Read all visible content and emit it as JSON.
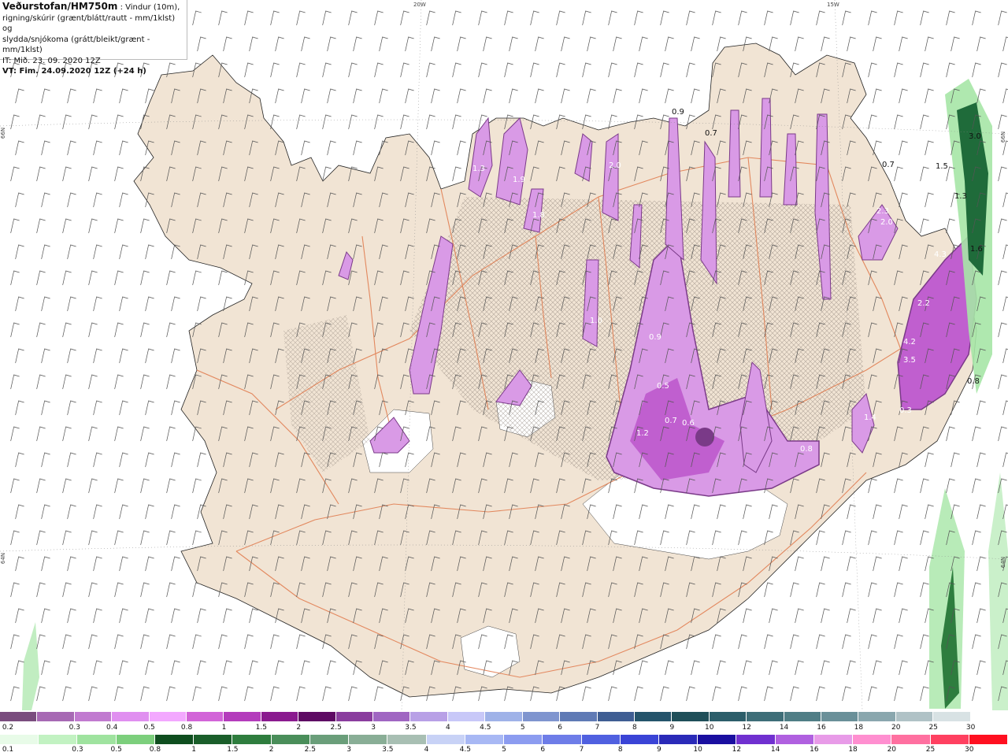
{
  "header": {
    "title": "Veðurstofan/HM750m",
    "title_suffix": " : Vindur (10m),",
    "line2": "rigning/skúrir (grænt/blátt/rautt - mm/1klst) og",
    "line3": "slydda/snjókoma (grátt/bleikt/grænt - mm/1klst)",
    "line4": "IT: Mið. 23. 09. 2020 12Z",
    "line5": "VT: Fim. 24.09.2020 12Z (+24 h)"
  },
  "map": {
    "longitude_labels": [
      "20W",
      "15W"
    ],
    "latitude_labels": [
      "66N",
      "64N",
      "66N",
      "64N"
    ],
    "colors": {
      "sea": "#ffffff",
      "land": "#f1e4d4",
      "roads": "#e0784a",
      "snow_light": "#d99ae6",
      "snow_mid": "#c05fcf",
      "snow_heavy": "#7a3a88",
      "rain_light": "#a6e6a6",
      "rain_heavy": "#1f6b3a",
      "glacier": "#ffffff",
      "wind_barb": "#555555"
    },
    "value_labels": [
      {
        "text": "0.9",
        "tone": "dark"
      },
      {
        "text": "0.7",
        "tone": "dark"
      },
      {
        "text": "3.0",
        "tone": "dark"
      },
      {
        "text": "1.5",
        "tone": "dark"
      },
      {
        "text": "1.3",
        "tone": "dark"
      },
      {
        "text": "0.7",
        "tone": "dark"
      },
      {
        "text": "1.6",
        "tone": "dark"
      },
      {
        "text": "0.8",
        "tone": "dark"
      },
      {
        "text": "1.3",
        "tone": "light"
      },
      {
        "text": "1.9",
        "tone": "light"
      },
      {
        "text": "2.0",
        "tone": "light"
      },
      {
        "text": "1.8",
        "tone": "light"
      },
      {
        "text": "4.3",
        "tone": "light"
      },
      {
        "text": "3.5",
        "tone": "light"
      },
      {
        "text": "4.2",
        "tone": "light"
      },
      {
        "text": "2.0",
        "tone": "light"
      },
      {
        "text": "2.3",
        "tone": "light"
      },
      {
        "text": "1.0",
        "tone": "light"
      },
      {
        "text": "0.9",
        "tone": "light"
      },
      {
        "text": "1.2",
        "tone": "light"
      },
      {
        "text": "0.5",
        "tone": "light"
      },
      {
        "text": "0.7",
        "tone": "light"
      },
      {
        "text": "0.6",
        "tone": "light"
      },
      {
        "text": "0.8",
        "tone": "light"
      },
      {
        "text": "1.4",
        "tone": "light"
      },
      {
        "text": "0.3",
        "tone": "light"
      },
      {
        "text": "2.2",
        "tone": "light"
      }
    ]
  },
  "legend": {
    "snow": {
      "labels": [
        "0.2",
        "0.3",
        "0.4",
        "0.5",
        "0.8",
        "1",
        "1.5",
        "2",
        "2.5",
        "3",
        "3.5",
        "4",
        "4.5",
        "5",
        "6",
        "7",
        "8",
        "9",
        "10",
        "12",
        "14",
        "16",
        "18",
        "20",
        "25",
        "30"
      ],
      "colors": [
        "#7a4d7e",
        "#a769b4",
        "#c17ad0",
        "#e08ff0",
        "#f3a8ff",
        "#d264d8",
        "#b43cbc",
        "#8a1a8f",
        "#5e0a63",
        "#8a3d9e",
        "#a066c2",
        "#b8a0e6",
        "#c8c8f8",
        "#9fb2e8",
        "#7f95cf",
        "#5f7ab5",
        "#3f5e93",
        "#25546b",
        "#1f4f59",
        "#2c5e6a",
        "#3e6e78",
        "#507e86",
        "#6a9099",
        "#8aa7ae",
        "#b0c2c6",
        "#d8e2e4",
        "#ffffff"
      ]
    },
    "rain": {
      "labels": [
        "0.1",
        "0.3",
        "0.5",
        "0.8",
        "1",
        "1.5",
        "2",
        "2.5",
        "3",
        "3.5",
        "4",
        "4.5",
        "5",
        "6",
        "7",
        "8",
        "9",
        "10",
        "12",
        "14",
        "16",
        "18",
        "20",
        "25",
        "30"
      ],
      "colors": [
        "#e8fbe8",
        "#c2f2c2",
        "#9fe39f",
        "#7ccf7c",
        "#0f4e1f",
        "#1a5e2a",
        "#2e7d3e",
        "#4a8e5a",
        "#6a9e7a",
        "#89ae96",
        "#a8bfb3",
        "#c8d2f6",
        "#a8b8f4",
        "#8c9cf0",
        "#6e7de8",
        "#5060e0",
        "#3a44d6",
        "#2a2ab8",
        "#1a0fa0",
        "#7030d0",
        "#b060e0",
        "#e89be8",
        "#ff8fd0",
        "#ff70a0",
        "#ff4060",
        "#ff1020"
      ]
    }
  }
}
